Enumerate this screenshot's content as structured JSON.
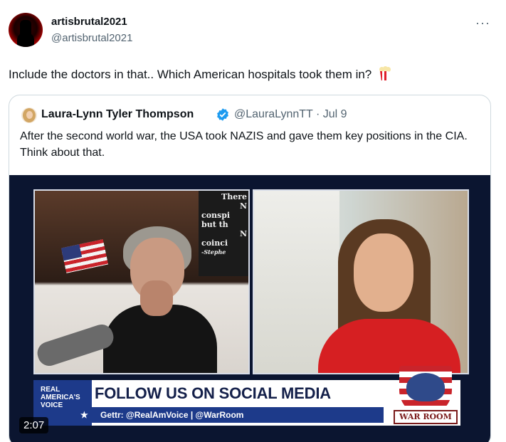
{
  "tweet": {
    "display_name": "artisbrutal2021",
    "handle": "@artisbrutal2021",
    "more_label": "···",
    "text": "Include the doctors in that.. Which American hospitals took them in?",
    "emoji_icon": "popcorn-icon"
  },
  "quoted_tweet": {
    "display_name": "Laura-Lynn Tyler Thompson",
    "handle_date": "@LauraLynnTT · Jul 9",
    "verified_icon": "verified-badge-icon",
    "verified_color": "#1d9bf0",
    "text": "After the second world war, the USA took NAZIS and gave them key positions in the CIA. Think about that.",
    "video": {
      "duration": "2:07",
      "bookshelf_text": [
        "There",
        "N",
        "conspi",
        "but th",
        "N",
        "coinci",
        "-Stephe"
      ],
      "network_logo": [
        "REAL",
        "AMERICA'S",
        "VOICE"
      ],
      "banner_title": "FOLLOW US ON SOCIAL MEDIA",
      "banner_subtitle": "Gettr: @RealAmVoice | @WarRoom",
      "show_logo": "WAR ROOM"
    }
  }
}
